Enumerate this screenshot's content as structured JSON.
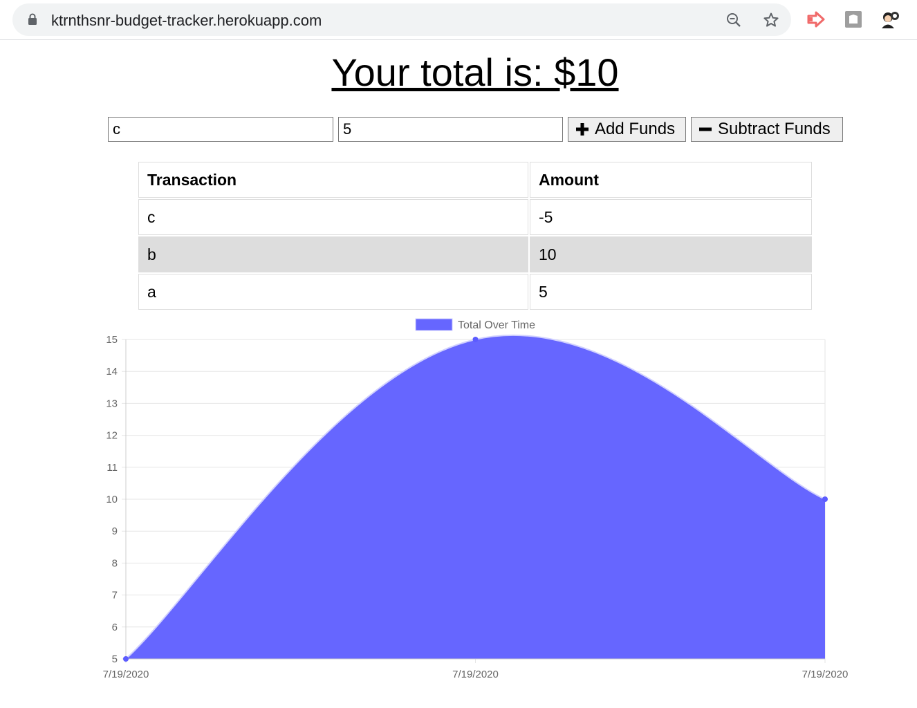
{
  "browser": {
    "url": "ktrnthsnr-budget-tracker.herokuapp.com",
    "icons": [
      "lock-icon",
      "zoom-out-icon",
      "star-icon",
      "extension-arrow-icon",
      "extension-box-icon",
      "profile-avatar-icon"
    ]
  },
  "page": {
    "title": "Your total is: $10"
  },
  "form": {
    "name_value": "c",
    "amount_value": "5",
    "add_label": "Add Funds",
    "subtract_label": "Subtract Funds"
  },
  "table": {
    "headers": [
      "Transaction",
      "Amount"
    ],
    "rows": [
      {
        "name": "c",
        "amount": "-5"
      },
      {
        "name": "b",
        "amount": "10"
      },
      {
        "name": "a",
        "amount": "5"
      }
    ]
  },
  "chart_data": {
    "type": "area",
    "legend": "Total Over Time",
    "legend_position": "top",
    "x": [
      "7/19/2020",
      "7/19/2020",
      "7/19/2020"
    ],
    "series": [
      {
        "name": "Total Over Time",
        "values": [
          5,
          15,
          10
        ]
      }
    ],
    "ylim": [
      5,
      15
    ],
    "yticks": [
      5,
      6,
      7,
      8,
      9,
      10,
      11,
      12,
      13,
      14,
      15
    ],
    "grid": true,
    "fill_color": "#6666ff",
    "line_color": "#d0d0ff",
    "point_color": "#5c5cff"
  }
}
